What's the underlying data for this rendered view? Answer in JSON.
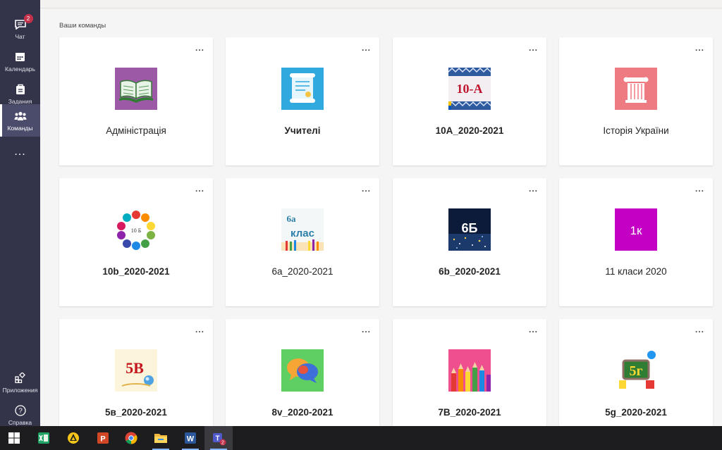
{
  "rail": {
    "items": [
      {
        "label": "Чат",
        "icon": "chat-icon",
        "badge": "2"
      },
      {
        "label": "Календарь",
        "icon": "calendar-icon"
      },
      {
        "label": "Задания",
        "icon": "assignments-icon"
      },
      {
        "label": "Команды",
        "icon": "teams-icon",
        "active": true
      },
      {
        "label": "...",
        "icon": "more-icon"
      }
    ],
    "bottom": [
      {
        "label": "Приложения",
        "icon": "apps-icon"
      },
      {
        "label": "Справка",
        "icon": "help-icon"
      }
    ]
  },
  "main": {
    "section_title": "Ваши команды",
    "more_label": "...",
    "teams": [
      {
        "name": "Адміністрація",
        "tile": "book"
      },
      {
        "name": "Учителі",
        "tile": "scroll"
      },
      {
        "name": "10А_2020-2021",
        "tile": "10a",
        "tile_text": "10-А"
      },
      {
        "name": "Історія України",
        "tile": "column"
      },
      {
        "name": "10b_2020-2021",
        "tile": "hands",
        "tile_text": "10 Б"
      },
      {
        "name": "6а_2020-2021",
        "tile": "6a",
        "tile_text_top": "6а",
        "tile_text_bottom": "клас"
      },
      {
        "name": "6b_2020-2021",
        "tile": "6b",
        "tile_text": "6Б"
      },
      {
        "name": "11 класи 2020",
        "tile": "1k",
        "tile_text": "1к"
      },
      {
        "name": "5в_2020-2021",
        "tile": "5v",
        "tile_text": "5В"
      },
      {
        "name": "8v_2020-2021",
        "tile": "chat"
      },
      {
        "name": "7В_2020-2021",
        "tile": "pencils"
      },
      {
        "name": "5g_2020-2021",
        "tile": "5g",
        "tile_text": "5г"
      }
    ]
  },
  "taskbar": {
    "items": [
      "windows-start-icon",
      "excel-icon",
      "arrow-app-icon",
      "powerpoint-icon",
      "chrome-icon",
      "file-explorer-icon",
      "word-icon",
      "teams-taskbar-icon"
    ],
    "teams_badge": "2"
  },
  "colors": {
    "rail": "#33344a",
    "rail_active": "#4b4c6b",
    "badge": "#c4314b",
    "taskbar": "#1d1d1f"
  }
}
